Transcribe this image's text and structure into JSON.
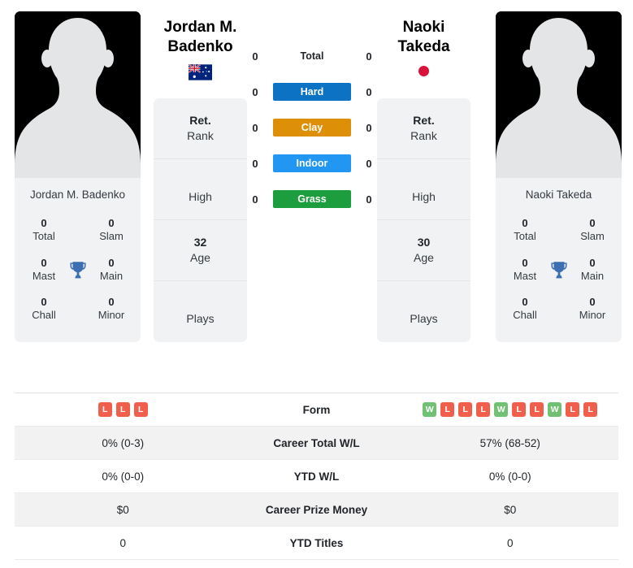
{
  "players": {
    "left": {
      "heading": "Jordan M.\nBadenko",
      "name_line1": "Jordan M.",
      "name_line2": "Badenko",
      "card_name": "Jordan M. Badenko",
      "flag": "australia-flag",
      "titles": [
        {
          "value": "0",
          "label": "Total"
        },
        {
          "value": "0",
          "label": "Slam"
        },
        {
          "value": "0",
          "label": "Mast"
        },
        {
          "value": "0",
          "label": "Main"
        },
        {
          "value": "0",
          "label": "Chall"
        },
        {
          "value": "0",
          "label": "Minor"
        }
      ],
      "info": [
        {
          "value": "Ret.",
          "label": "Rank"
        },
        {
          "value": "",
          "label": "High"
        },
        {
          "value": "32",
          "label": "Age"
        },
        {
          "value": "",
          "label": "Plays"
        }
      ],
      "surface_counts": {
        "total": "0",
        "hard": "0",
        "clay": "0",
        "indoor": "0",
        "grass": "0"
      },
      "form": [
        "L",
        "L",
        "L"
      ],
      "career_total_wl": "0% (0-3)",
      "ytd_wl": "0% (0-0)",
      "career_prize_money": "$0",
      "ytd_titles": "0"
    },
    "right": {
      "heading": "Naoki\nTakeda",
      "name_line1": "Naoki",
      "name_line2": "Takeda",
      "card_name": "Naoki Takeda",
      "flag": "japan-flag",
      "titles": [
        {
          "value": "0",
          "label": "Total"
        },
        {
          "value": "0",
          "label": "Slam"
        },
        {
          "value": "0",
          "label": "Mast"
        },
        {
          "value": "0",
          "label": "Main"
        },
        {
          "value": "0",
          "label": "Chall"
        },
        {
          "value": "0",
          "label": "Minor"
        }
      ],
      "info": [
        {
          "value": "Ret.",
          "label": "Rank"
        },
        {
          "value": "",
          "label": "High"
        },
        {
          "value": "30",
          "label": "Age"
        },
        {
          "value": "",
          "label": "Plays"
        }
      ],
      "surface_counts": {
        "total": "0",
        "hard": "0",
        "clay": "0",
        "indoor": "0",
        "grass": "0"
      },
      "form": [
        "W",
        "L",
        "L",
        "L",
        "W",
        "L",
        "L",
        "W",
        "L",
        "L"
      ],
      "career_total_wl": "57% (68-52)",
      "ytd_wl": "0% (0-0)",
      "career_prize_money": "$0",
      "ytd_titles": "0"
    }
  },
  "surfaces": [
    {
      "key": "total",
      "label": "Total",
      "color": "transparent"
    },
    {
      "key": "hard",
      "label": "Hard",
      "color": "#0b72c4"
    },
    {
      "key": "clay",
      "label": "Clay",
      "color": "#dd9007"
    },
    {
      "key": "indoor",
      "label": "Indoor",
      "color": "#2196f3"
    },
    {
      "key": "grass",
      "label": "Grass",
      "color": "#1d9e3e"
    }
  ],
  "stats_rows": [
    {
      "key": "form",
      "label": "Form"
    },
    {
      "key": "career_total_wl",
      "label": "Career Total W/L"
    },
    {
      "key": "ytd_wl",
      "label": "YTD W/L"
    },
    {
      "key": "career_prize_money",
      "label": "Career Prize Money"
    },
    {
      "key": "ytd_titles",
      "label": "YTD Titles"
    }
  ],
  "labels": {
    "form": "Form",
    "career_total_wl": "Career Total W/L",
    "ytd_wl": "YTD W/L",
    "career_prize_money": "Career Prize Money",
    "ytd_titles": "YTD Titles"
  },
  "colors": {
    "hard": "#0b72c4",
    "clay": "#dd9007",
    "indoor": "#2196f3",
    "grass": "#1d9e3e",
    "win_badge": "#71c174",
    "loss_badge": "#ef5f4c",
    "trophy": "#3d6eb0",
    "card_bg": "#f1f2f3",
    "avatar_bg": "#000000",
    "silhouette": "#e4e5e6"
  }
}
